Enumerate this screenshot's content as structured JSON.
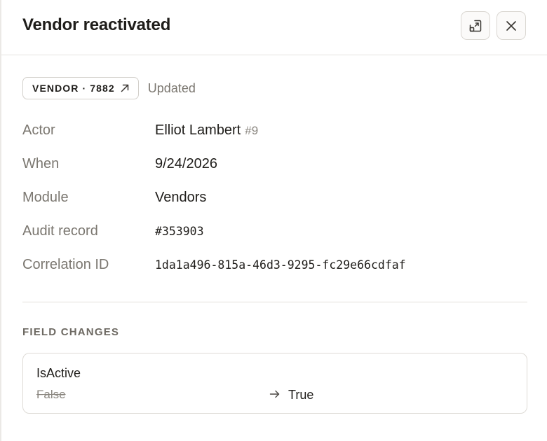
{
  "header": {
    "title": "Vendor reactivated",
    "expand_icon": "open-in-panel-icon",
    "close_icon": "close-icon"
  },
  "entity": {
    "badge_label": "VENDOR · 7882",
    "badge_icon": "arrow-up-right-icon",
    "status": "Updated"
  },
  "details": {
    "actor": {
      "label": "Actor",
      "name": "Elliot Lambert",
      "id": "#9"
    },
    "when": {
      "label": "When",
      "value": "9/24/2026"
    },
    "module": {
      "label": "Module",
      "value": "Vendors"
    },
    "audit_record": {
      "label": "Audit record",
      "value": "#353903"
    },
    "correlation_id": {
      "label": "Correlation ID",
      "value": "1da1a496-815a-46d3-9295-fc29e66cdfaf"
    }
  },
  "field_changes": {
    "section_title": "FIELD CHANGES",
    "items": [
      {
        "field": "IsActive",
        "old": "False",
        "new": "True"
      }
    ]
  },
  "colors": {
    "text_primary": "#1f1d1a",
    "text_muted": "#7b7770",
    "border": "#dedbd6"
  }
}
